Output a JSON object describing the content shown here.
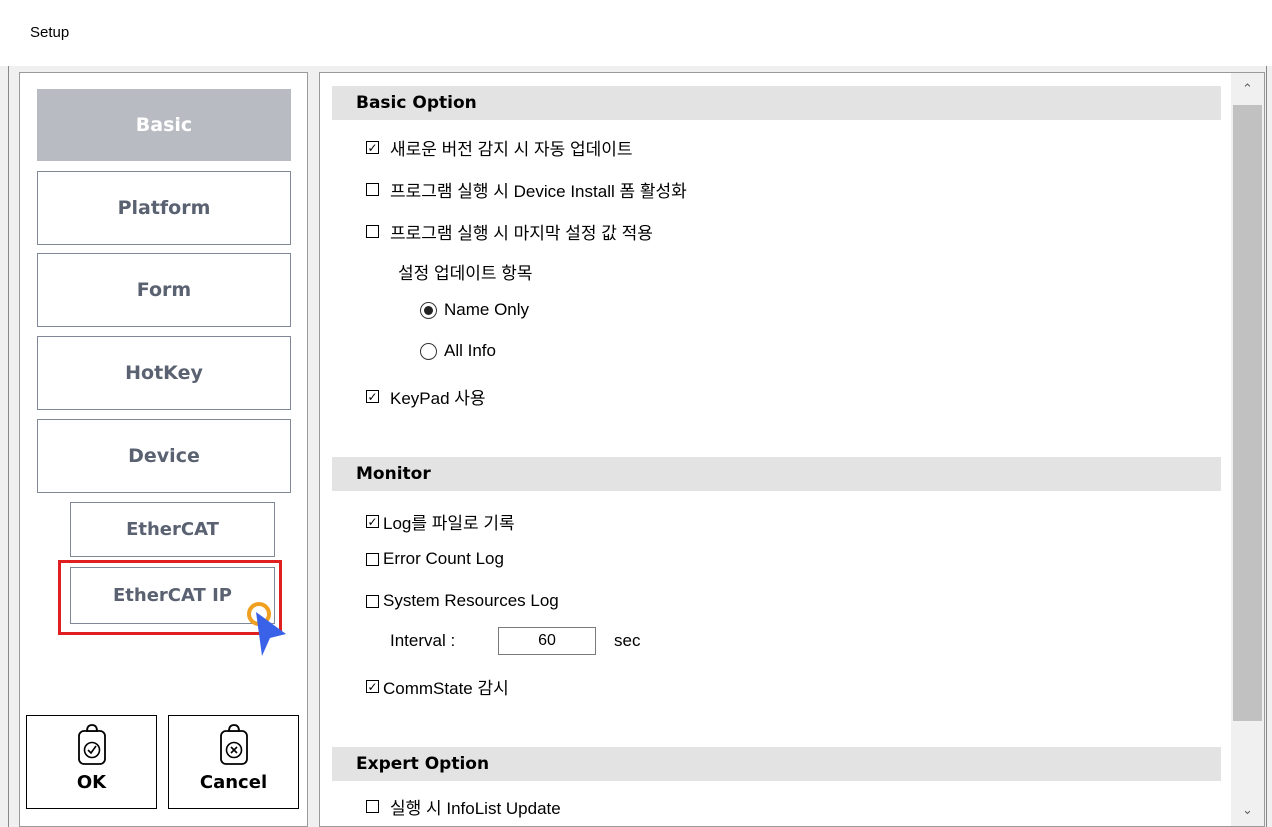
{
  "window": {
    "title": "Setup"
  },
  "nav": {
    "items": [
      {
        "label": "Basic",
        "active": true
      },
      {
        "label": "Platform"
      },
      {
        "label": "Form"
      },
      {
        "label": "HotKey"
      },
      {
        "label": "Device"
      },
      {
        "label": "EtherCAT"
      },
      {
        "label": "EtherCAT IP"
      }
    ],
    "ok_label": "OK",
    "cancel_label": "Cancel"
  },
  "basic_option": {
    "header": "Basic Option",
    "auto_update": {
      "label": "새로운 버전 감지 시 자동 업데이트",
      "checked": true
    },
    "device_install_form": {
      "label": "프로그램 실행 시 Device Install 폼 활성화",
      "checked": false
    },
    "apply_last_settings": {
      "label": "프로그램 실행 시 마지막 설정 값 적용",
      "checked": false
    },
    "update_items_label": "설정 업데이트 항목",
    "name_only": {
      "label": "Name Only",
      "selected": true
    },
    "all_info": {
      "label": "All Info",
      "selected": false
    },
    "keypad": {
      "label": "KeyPad 사용",
      "checked": true
    }
  },
  "monitor": {
    "header": "Monitor",
    "log_to_file": {
      "label": "Log를 파일로 기록",
      "checked": true
    },
    "error_count_log": {
      "label": "Error Count Log",
      "checked": false
    },
    "system_resources_log": {
      "label": "System Resources Log",
      "checked": false
    },
    "interval_label": "Interval :",
    "interval_value": "60",
    "interval_unit": "sec",
    "commstate": {
      "label": "CommState 감시",
      "checked": true
    }
  },
  "expert_option": {
    "header": "Expert Option",
    "infolist_update": {
      "label": "실행 시 InfoList Update",
      "checked": false
    }
  },
  "colors": {
    "highlight": "#e02020",
    "active_nav_bg": "#b8bcc2",
    "cursor": "#3a62e8"
  }
}
